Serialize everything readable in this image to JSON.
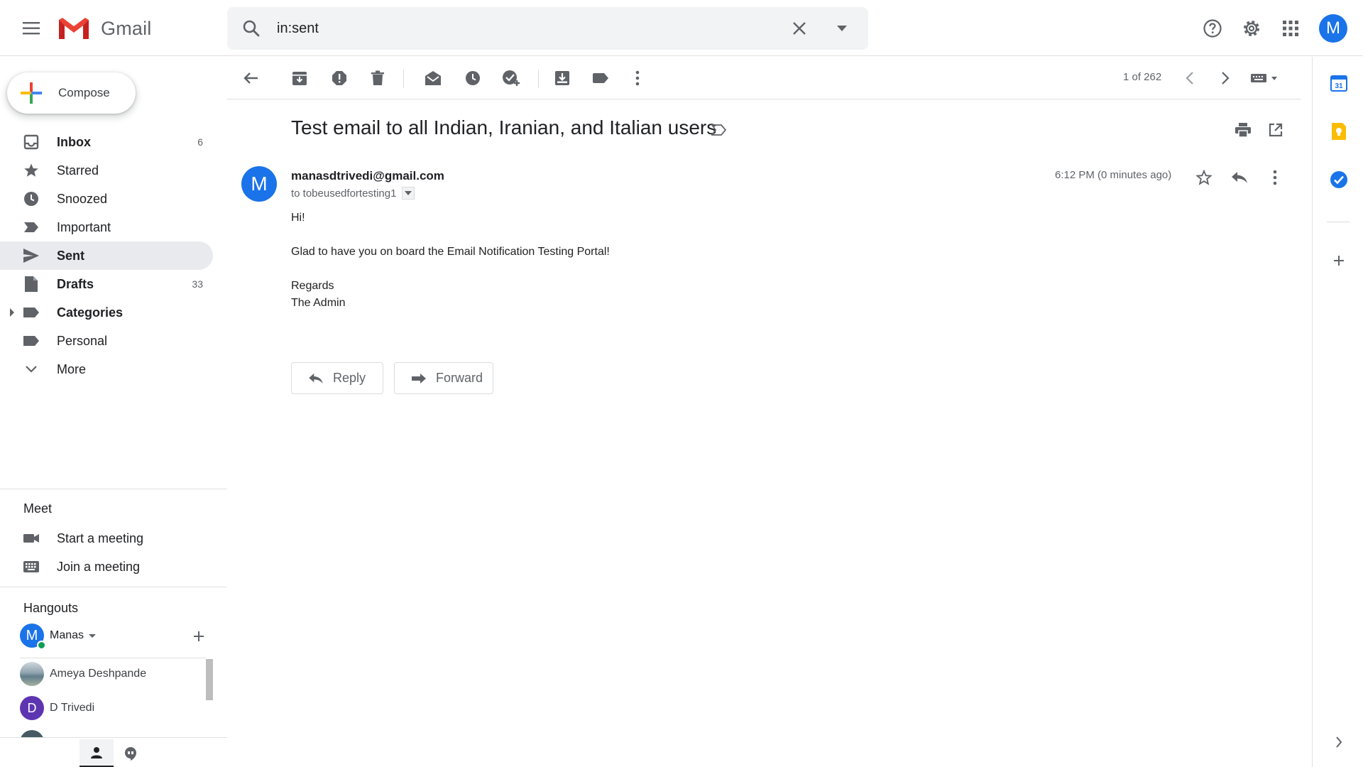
{
  "header": {
    "app_name": "Gmail",
    "search_value": "in:sent",
    "profile_initial": "M"
  },
  "compose": {
    "label": "Compose"
  },
  "nav": [
    {
      "label": "Inbox",
      "count": "6",
      "bold": true
    },
    {
      "label": "Starred",
      "count": "",
      "bold": false
    },
    {
      "label": "Snoozed",
      "count": "",
      "bold": false
    },
    {
      "label": "Important",
      "count": "",
      "bold": false
    },
    {
      "label": "Sent",
      "count": "",
      "bold": true
    },
    {
      "label": "Drafts",
      "count": "33",
      "bold": true
    },
    {
      "label": "Categories",
      "count": "",
      "bold": true
    },
    {
      "label": "Personal",
      "count": "",
      "bold": false
    },
    {
      "label": "More",
      "count": "",
      "bold": false
    }
  ],
  "meet": {
    "title": "Meet",
    "start": "Start a meeting",
    "join": "Join a meeting"
  },
  "hangouts": {
    "title": "Hangouts",
    "user_name": "Manas",
    "user_initial": "M",
    "contacts": [
      {
        "name": "Ameya Deshpande",
        "initial": ""
      },
      {
        "name": "D Trivedi",
        "initial": "D"
      }
    ]
  },
  "toolbar": {
    "pager": "1 of 262"
  },
  "email": {
    "subject": "Test email to all Indian, Iranian, and Italian users",
    "sender_initial": "M",
    "sender": "manasdtrivedi@gmail.com",
    "to": "to tobeusedfortesting1",
    "timestamp": "6:12 PM (0 minutes ago)",
    "body": [
      "Hi!",
      "Glad to have you on board the Email Notification Testing Portal!",
      "Regards",
      "The Admin"
    ],
    "reply_label": "Reply",
    "forward_label": "Forward"
  },
  "colors": {
    "accent": "#1a73e8",
    "active_nav": "#e8eaed",
    "online": "#0f9d58",
    "gmail_red": "#ea4335"
  },
  "icons": {
    "menu": "hamburger-icon",
    "search": "search-icon",
    "help": "help-icon",
    "settings": "gear-icon",
    "apps": "apps-grid-icon",
    "calendar": "calendar-icon",
    "keep": "keep-icon",
    "tasks": "tasks-icon"
  }
}
